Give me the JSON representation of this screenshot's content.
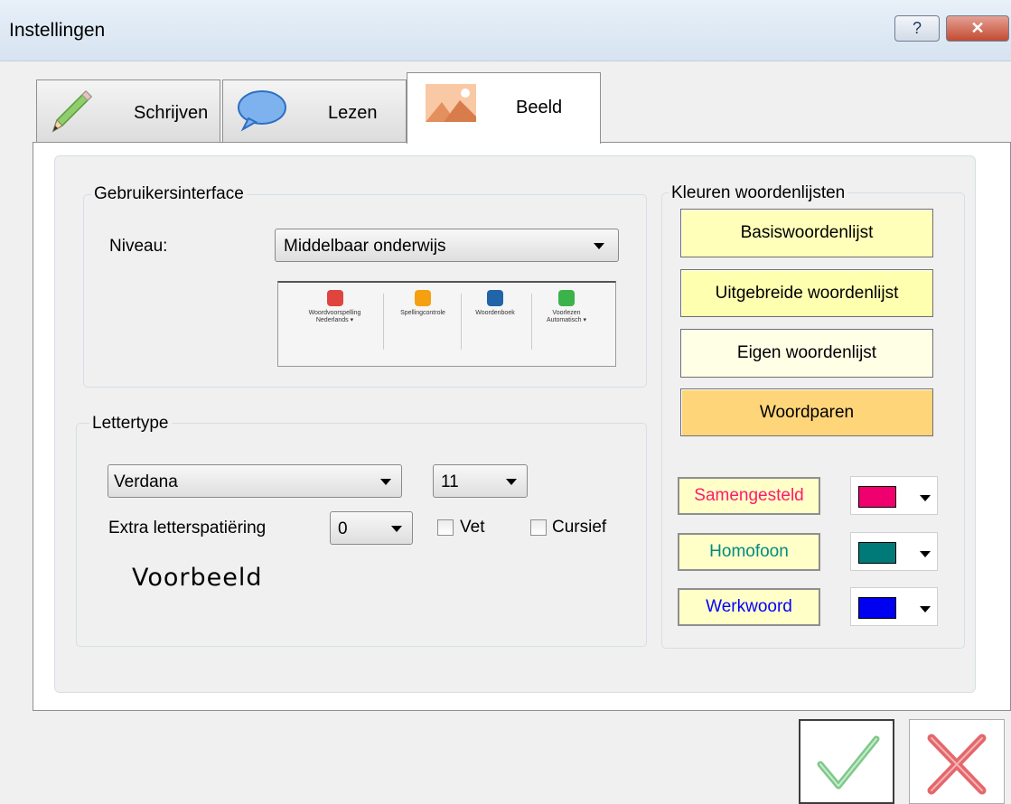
{
  "window": {
    "title": "Instellingen",
    "help_glyph": "?",
    "close_glyph": "✕"
  },
  "tabs": [
    {
      "label": "Schrijven",
      "icon": "pencil-icon",
      "active": false
    },
    {
      "label": "Lezen",
      "icon": "speech-bubble-icon",
      "active": false
    },
    {
      "label": "Beeld",
      "icon": "image-icon",
      "active": true
    }
  ],
  "gebruikersinterface": {
    "legend": "Gebruikersinterface",
    "niveau_label": "Niveau:",
    "niveau_value": "Middelbaar onderwijs",
    "preview_items": [
      {
        "label": "Woordvoorspelling\nNederlands ▾",
        "color": "#e0443e"
      },
      {
        "label": "Spellingcontrole",
        "color": "#f5a00f"
      },
      {
        "label": "Woordenboek",
        "color": "#2164a8"
      },
      {
        "label": "Voorlezen\nAutomatisch ▾",
        "color": "#3cb34a"
      }
    ]
  },
  "lettertype": {
    "legend": "Lettertype",
    "font_value": "Verdana",
    "size_value": "11",
    "spacing_label": "Extra letterspatiëring",
    "spacing_value": "0",
    "bold_label": "Vet",
    "bold_checked": false,
    "italic_label": "Cursief",
    "italic_checked": false,
    "preview_text": "Voorbeeld"
  },
  "kleuren": {
    "legend": "Kleuren woordenlijsten",
    "buttons": [
      {
        "label": "Basiswoordenlijst",
        "color": "#ffffb9"
      },
      {
        "label": "Uitgebreide woordenlijst",
        "color": "#ffffb0"
      },
      {
        "label": "Eigen woordenlijst",
        "color": "#ffffe6"
      },
      {
        "label": "Woordparen",
        "color": "#ffd57a"
      }
    ],
    "color_rows": [
      {
        "label": "Samengesteld",
        "text_color": "#ff1a6c",
        "swatch": "#f0006e"
      },
      {
        "label": "Homofoon",
        "text_color": "#008b82",
        "swatch": "#007a78"
      },
      {
        "label": "Werkwoord",
        "text_color": "#0000ff",
        "swatch": "#0000f0"
      }
    ]
  },
  "footer": {
    "ok_icon": "checkmark-icon",
    "cancel_icon": "x-icon"
  }
}
